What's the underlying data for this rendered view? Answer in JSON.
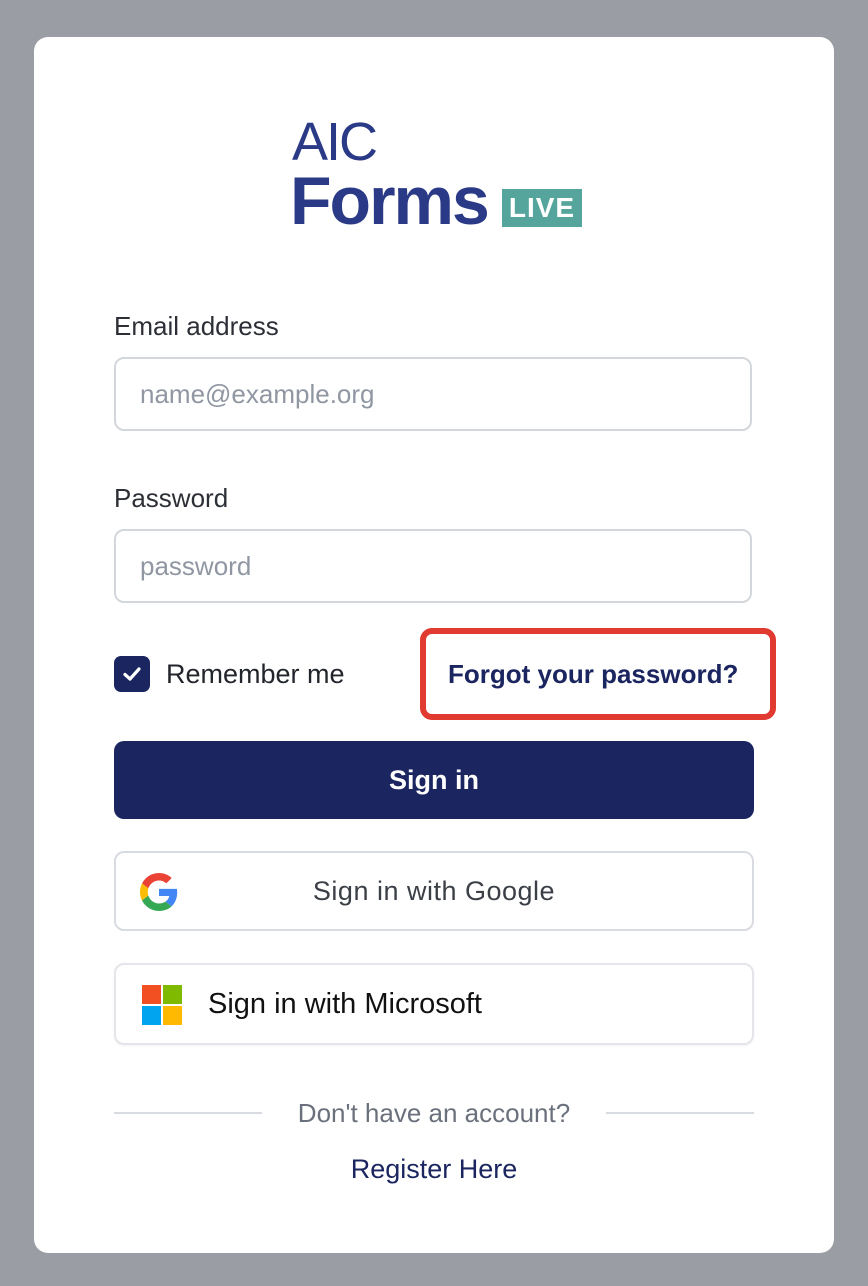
{
  "logo": {
    "line1": "AIC",
    "line2": "Forms",
    "badge": "LIVE"
  },
  "form": {
    "email_label": "Email address",
    "email_placeholder": "name@example.org",
    "email_value": "",
    "password_label": "Password",
    "password_placeholder": "password",
    "password_value": "",
    "remember_label": "Remember me",
    "remember_checked": true,
    "forgot_link": "Forgot your password?",
    "sign_in_button": "Sign in",
    "google_button": "Sign in with Google",
    "microsoft_button": "Sign in with Microsoft",
    "no_account_text": "Don't have an account?",
    "register_link": "Register Here"
  },
  "colors": {
    "brand_navy": "#1b2560",
    "logo_blue": "#2b3a86",
    "live_badge": "#55a59c",
    "highlight_outline": "#e03a31",
    "backdrop": "#9a9da4"
  },
  "icons": [
    "check-icon",
    "google-icon",
    "microsoft-icon"
  ]
}
